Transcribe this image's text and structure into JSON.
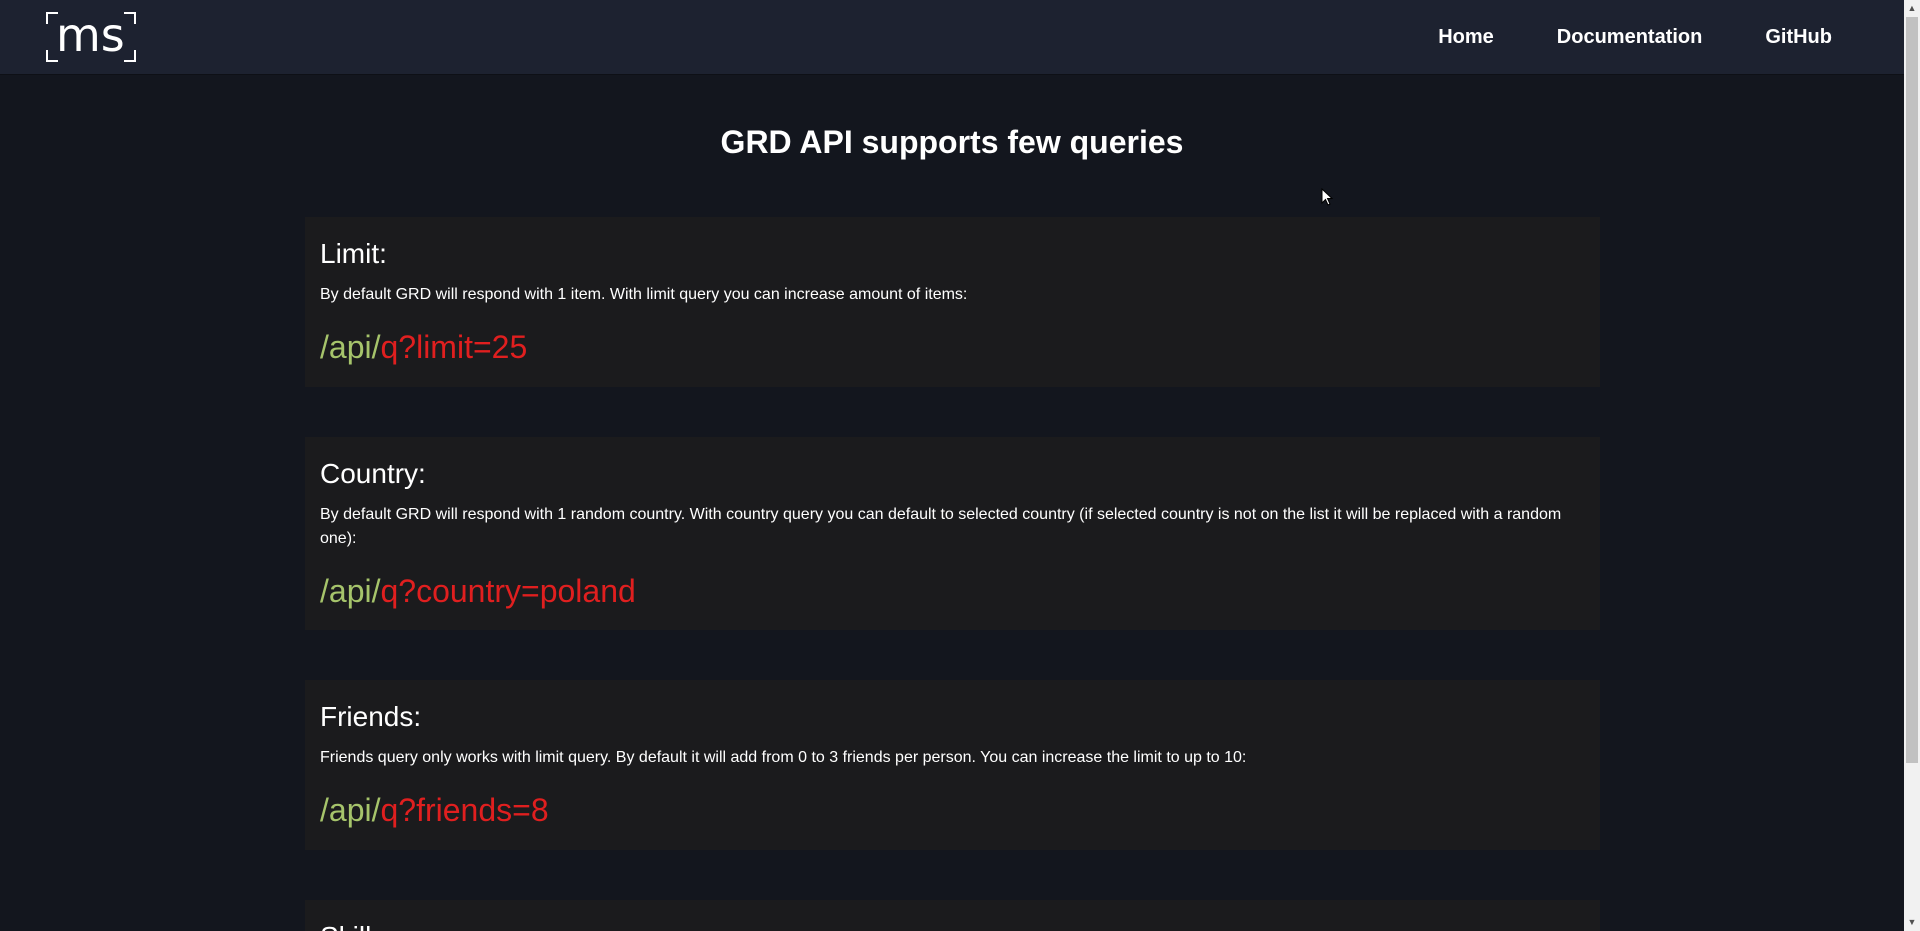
{
  "logo": {
    "text": "ms",
    "icon": "ms-logo"
  },
  "nav": {
    "items": [
      {
        "label": "Home"
      },
      {
        "label": "Documentation"
      },
      {
        "label": "GitHub"
      }
    ]
  },
  "page": {
    "title": "GRD API supports few queries"
  },
  "sections": [
    {
      "title": "Limit:",
      "description": "By default GRD will respond with 1 item. With limit query you can increase amount of items:",
      "code_base": "/api/",
      "code_query": "q?limit=25"
    },
    {
      "title": "Country:",
      "description": "By default GRD will respond with 1 random country. With country query you can default to selected country (if selected country is not on the list it will be replaced with a random one):",
      "code_base": "/api/",
      "code_query": "q?country=poland"
    },
    {
      "title": "Friends:",
      "description": "Friends query only works with limit query. By default it will add from 0 to 3 friends per person. You can increase the limit to up to 10:",
      "code_base": "/api/",
      "code_query": "q?friends=8"
    },
    {
      "title": "Skills:"
    }
  ],
  "colors": {
    "background": "#13161e",
    "navbar": "#1d2230",
    "card": "#1b1b1d",
    "code_base": "#a6c46b",
    "code_query": "#e01f1f"
  }
}
